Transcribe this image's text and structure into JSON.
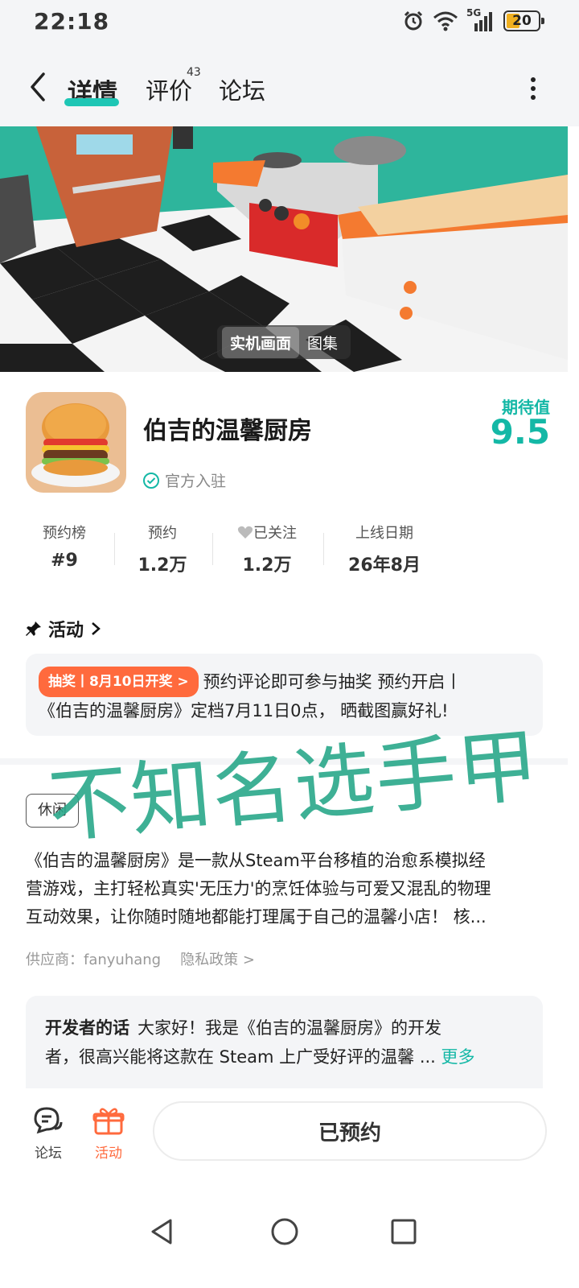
{
  "status_bar": {
    "time": "22:18",
    "network": "5G",
    "battery": "20"
  },
  "header": {
    "tabs": [
      {
        "label": "详情",
        "active": true
      },
      {
        "label": "评价",
        "badge": "43"
      },
      {
        "label": "论坛"
      }
    ]
  },
  "hero": {
    "switch": [
      "实机画面",
      "图集"
    ]
  },
  "game": {
    "title": "伯吉的温馨厨房",
    "official": "官方入驻",
    "expect_label": "期待值",
    "expect_score": "9.5"
  },
  "stats": [
    {
      "label": "预约榜",
      "value": "#9"
    },
    {
      "label": "预约",
      "value": "1.2万"
    },
    {
      "label": "已关注",
      "value": "1.2万"
    },
    {
      "label": "上线日期",
      "value": "26年8月"
    }
  ],
  "activity": {
    "heading": "活动",
    "tag": "抽奖丨8月10日开奖 >",
    "line1": "预约评论即可参与抽奖 预约开启丨",
    "line2": "《伯吉的温馨厨房》定档7月11日0点， 晒截图赢好礼!"
  },
  "description": {
    "genre": "休闲",
    "lines": [
      "《伯吉的温馨厨房》是一款从Steam平台移植的治愈系模拟经",
      "营游戏，主打轻松真实'无压力'的烹饪体验与可爱又混乱的物理",
      "互动效果，让你随时随地都能打理属于自己的温馨小店！ 核..."
    ],
    "supplier": "供应商：fanyuhang",
    "privacy": "隐私政策 >"
  },
  "developer": {
    "title": "开发者的话",
    "line1": "大家好！我是《伯吉的温馨厨房》的开发",
    "line2": "者，很高兴能将这款在 Steam 上广受好评的温馨 ...",
    "more": "更多"
  },
  "bottom_bar": {
    "forum": "论坛",
    "activity": "活动",
    "reserved": "已预约"
  },
  "watermark": "不知名选手甲",
  "colors": {
    "accent": "#14b8a6",
    "orange": "#ff6a3d",
    "watermark": "#2aa88a"
  }
}
